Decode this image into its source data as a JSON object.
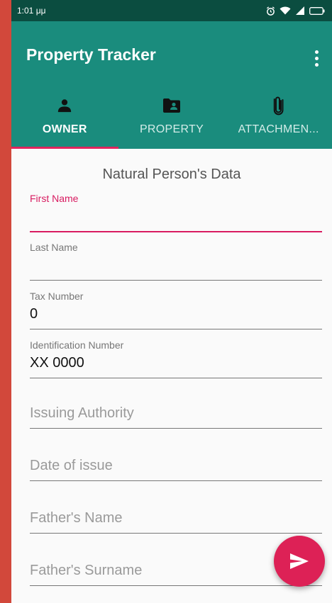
{
  "status_bar": {
    "time": "1:01 μμ"
  },
  "app_bar": {
    "title": "Property Tracker"
  },
  "tabs": [
    {
      "label": "OWNER",
      "icon": "person-icon",
      "active": true
    },
    {
      "label": "PROPERTY",
      "icon": "folder-person-icon",
      "active": false
    },
    {
      "label": "ATTACHMEN...",
      "icon": "paperclip-icon",
      "active": false
    }
  ],
  "form": {
    "section_title": "Natural Person's Data",
    "first_name": {
      "label": "First Name",
      "value": ""
    },
    "last_name": {
      "label": "Last Name",
      "value": ""
    },
    "tax_number": {
      "label": "Tax Number",
      "value": "0"
    },
    "identification_number": {
      "label": "Identification Number",
      "value": "XX 0000"
    },
    "issuing_authority": {
      "placeholder": "Issuing Authority"
    },
    "date_of_issue": {
      "placeholder": "Date of issue"
    },
    "fathers_name": {
      "placeholder": "Father's Name"
    },
    "fathers_surname": {
      "placeholder": "Father's Surname"
    }
  },
  "colors": {
    "primary": "#1a8c7d",
    "primary_dark": "#0b4d40",
    "accent": "#dd2156"
  },
  "fab": {
    "icon": "send-icon"
  }
}
